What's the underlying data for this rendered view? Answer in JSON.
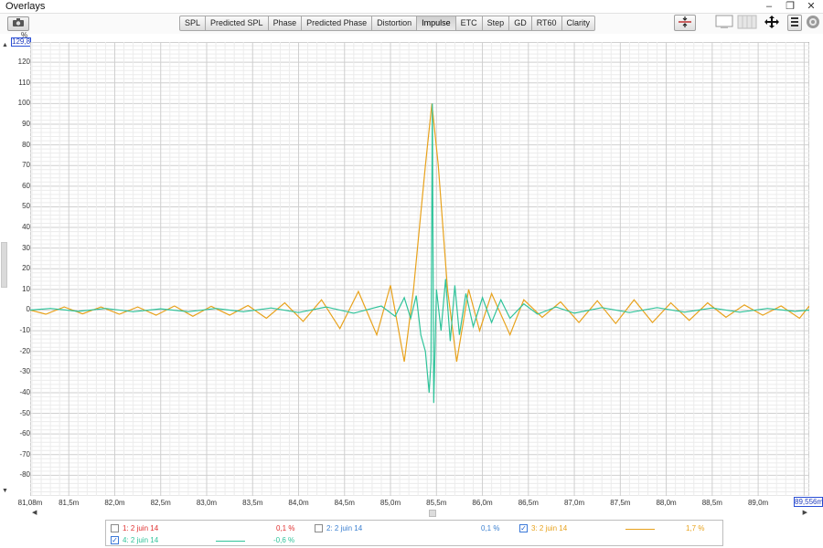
{
  "window": {
    "title": "Overlays",
    "controls": {
      "minimize": "–",
      "restore": "❐",
      "close": "✕"
    }
  },
  "toolbar": {
    "camera_icon": "camera-icon",
    "tabs": [
      {
        "label": "SPL",
        "active": false
      },
      {
        "label": "Predicted SPL",
        "active": false
      },
      {
        "label": "Phase",
        "active": false
      },
      {
        "label": "Predicted Phase",
        "active": false
      },
      {
        "label": "Distortion",
        "active": false
      },
      {
        "label": "Impulse",
        "active": true
      },
      {
        "label": "ETC",
        "active": false
      },
      {
        "label": "Step",
        "active": false
      },
      {
        "label": "GD",
        "active": false
      },
      {
        "label": "RT60",
        "active": false
      },
      {
        "label": "Clarity",
        "active": false
      }
    ],
    "right_icons": [
      "align-traces-icon",
      "blank-display-icon",
      "grid-toggle-icon",
      "move-icon",
      "controls-icon",
      "settings-gear-icon"
    ]
  },
  "y_axis": {
    "unit": "%",
    "top_value": "129,8"
  },
  "x_axis": {
    "end_value": "89,556m"
  },
  "chart_data": {
    "type": "line",
    "xlabel": "",
    "ylabel": "%",
    "x_ticks": [
      "81,08m",
      "81,5m",
      "82,0m",
      "82,5m",
      "83,0m",
      "83,5m",
      "84,0m",
      "84,5m",
      "85,0m",
      "85,5m",
      "86,0m",
      "86,5m",
      "87,0m",
      "87,5m",
      "88,0m",
      "88,5m",
      "89,0m"
    ],
    "y_ticks": [
      "120",
      "110",
      "100",
      "90",
      "80",
      "70",
      "60",
      "50",
      "40",
      "30",
      "20",
      "10",
      "0",
      "-10",
      "-20",
      "-30",
      "-40",
      "-50",
      "-60",
      "-70",
      "-80"
    ],
    "xlim": [
      81.08,
      89.556
    ],
    "ylim": [
      -90,
      129.8
    ],
    "grid": true,
    "series": [
      {
        "name": "3: 2 juin 14",
        "color": "#e8a21c",
        "points": [
          [
            81.08,
            0.0
          ],
          [
            81.25,
            -2.0
          ],
          [
            81.45,
            1.5
          ],
          [
            81.65,
            -1.8
          ],
          [
            81.85,
            1.5
          ],
          [
            82.05,
            -2.0
          ],
          [
            82.25,
            1.5
          ],
          [
            82.45,
            -2.5
          ],
          [
            82.65,
            2.0
          ],
          [
            82.85,
            -3.0
          ],
          [
            83.05,
            1.8
          ],
          [
            83.25,
            -2.5
          ],
          [
            83.45,
            2.2
          ],
          [
            83.65,
            -4.0
          ],
          [
            83.85,
            3.5
          ],
          [
            84.05,
            -5.5
          ],
          [
            84.25,
            5.0
          ],
          [
            84.45,
            -9.0
          ],
          [
            84.65,
            9.0
          ],
          [
            84.85,
            -12.0
          ],
          [
            85.0,
            12.0
          ],
          [
            85.15,
            -25.0
          ],
          [
            85.25,
            10.0
          ],
          [
            85.38,
            70.0
          ],
          [
            85.45,
            100.0
          ],
          [
            85.52,
            70.0
          ],
          [
            85.62,
            10.0
          ],
          [
            85.72,
            -25.0
          ],
          [
            85.85,
            10.0
          ],
          [
            85.97,
            -10.0
          ],
          [
            86.1,
            8.0
          ],
          [
            86.3,
            -12.0
          ],
          [
            86.45,
            5.0
          ],
          [
            86.65,
            -3.5
          ],
          [
            86.85,
            4.0
          ],
          [
            87.05,
            -6.0
          ],
          [
            87.25,
            4.5
          ],
          [
            87.45,
            -6.5
          ],
          [
            87.65,
            5.0
          ],
          [
            87.85,
            -6.0
          ],
          [
            88.05,
            3.5
          ],
          [
            88.25,
            -5.0
          ],
          [
            88.45,
            3.5
          ],
          [
            88.65,
            -3.5
          ],
          [
            88.85,
            2.5
          ],
          [
            89.05,
            -2.5
          ],
          [
            89.25,
            2.0
          ],
          [
            89.45,
            -4.0
          ],
          [
            89.556,
            2.0
          ]
        ]
      },
      {
        "name": "4: 2 juin 14",
        "color": "#2fc39a",
        "points": [
          [
            81.08,
            0.0
          ],
          [
            81.3,
            0.8
          ],
          [
            81.6,
            -0.6
          ],
          [
            81.9,
            0.8
          ],
          [
            82.2,
            -0.8
          ],
          [
            82.5,
            0.6
          ],
          [
            82.8,
            -0.8
          ],
          [
            83.1,
            0.8
          ],
          [
            83.4,
            -0.8
          ],
          [
            83.7,
            1.0
          ],
          [
            84.0,
            -1.2
          ],
          [
            84.3,
            1.5
          ],
          [
            84.6,
            -1.5
          ],
          [
            84.9,
            2.0
          ],
          [
            85.05,
            -3.0
          ],
          [
            85.15,
            6.0
          ],
          [
            85.22,
            -4.0
          ],
          [
            85.28,
            7.0
          ],
          [
            85.33,
            -12.0
          ],
          [
            85.38,
            -20.0
          ],
          [
            85.42,
            -40.0
          ],
          [
            85.44,
            -25.0
          ],
          [
            85.455,
            100.0
          ],
          [
            85.47,
            -45.0
          ],
          [
            85.5,
            10.0
          ],
          [
            85.55,
            -10.0
          ],
          [
            85.6,
            15.0
          ],
          [
            85.65,
            -15.0
          ],
          [
            85.7,
            12.0
          ],
          [
            85.75,
            -12.0
          ],
          [
            85.82,
            8.0
          ],
          [
            85.9,
            -8.0
          ],
          [
            86.0,
            6.0
          ],
          [
            86.1,
            -6.0
          ],
          [
            86.2,
            5.0
          ],
          [
            86.3,
            -4.0
          ],
          [
            86.45,
            3.0
          ],
          [
            86.6,
            -2.0
          ],
          [
            86.8,
            1.5
          ],
          [
            87.0,
            -1.5
          ],
          [
            87.3,
            1.2
          ],
          [
            87.6,
            -1.2
          ],
          [
            87.9,
            1.2
          ],
          [
            88.2,
            -1.0
          ],
          [
            88.5,
            1.0
          ],
          [
            88.8,
            -1.0
          ],
          [
            89.1,
            0.8
          ],
          [
            89.4,
            -0.6
          ],
          [
            89.556,
            0.0
          ]
        ]
      }
    ]
  },
  "legend": {
    "items": [
      {
        "label": "1: 2 juin 14",
        "value": "0,1 %",
        "checked": false,
        "color": "#e03030"
      },
      {
        "label": "2: 2 juin 14",
        "value": "0,1 %",
        "checked": false,
        "color": "#3a7fd0"
      },
      {
        "label": "3: 2 juin 14",
        "value": "1,7 %",
        "checked": true,
        "color": "#e8a21c"
      },
      {
        "label": "4: 2 juin 14",
        "value": "-0,6 %",
        "checked": true,
        "color": "#2fc39a"
      }
    ]
  }
}
